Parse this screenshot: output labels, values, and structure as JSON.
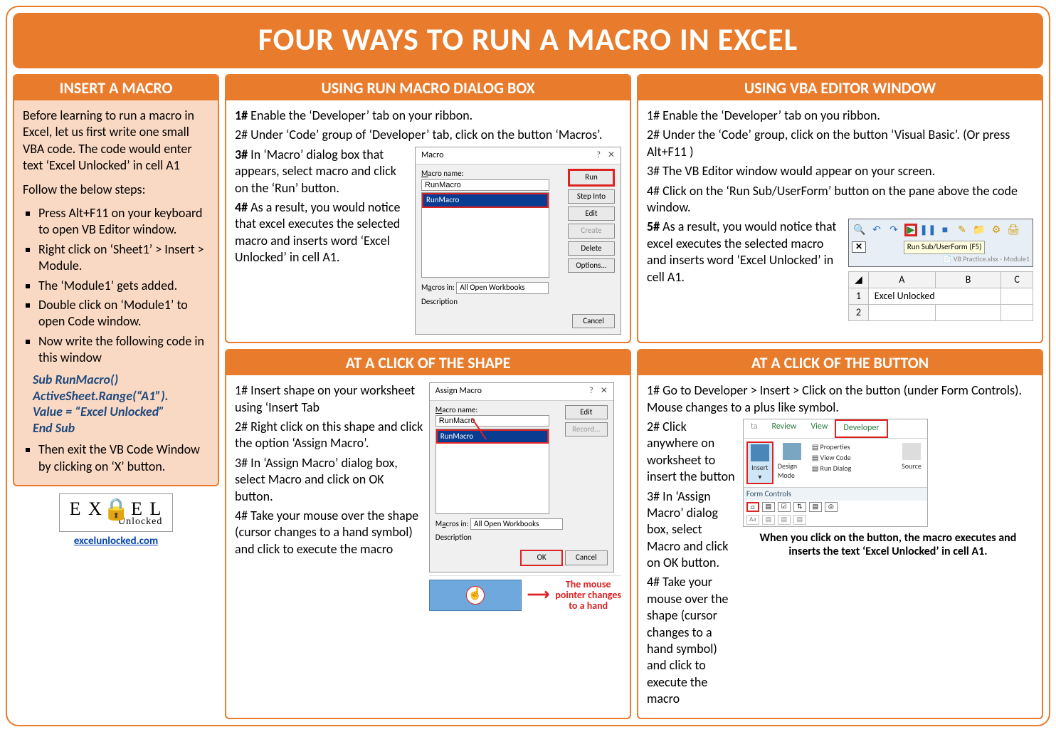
{
  "title": "FOUR WAYS TO RUN A MACRO IN EXCEL",
  "left": {
    "header": "INSERT A MACRO",
    "intro": "Before learning to run a macro in Excel, let us first write one small VBA code. The code would enter text ‘Excel Unlocked’ in cell A1",
    "follow": "Follow the below steps:",
    "steps": [
      "Press Alt+F11 on your keyboard to open VB Editor window.",
      "Right click on ‘Sheet1’ > Insert > Module.",
      "The ‘Module1’ gets added.",
      "Double click on ‘Module1’ to open Code window.",
      "Now write the following code in this window"
    ],
    "code": {
      "l1": "Sub RunMacro()",
      "l2": "ActiveSheet.Range(“A1”).",
      "l3": "Value = “Excel Unlocked”",
      "l4": "End Sub"
    },
    "after": "Then exit the VB Code Window by clicking on ‘X’ button.",
    "logo_top": "E X   E L",
    "logo_mid": "●",
    "logo_bottom": "Unlocked",
    "site": "excelunlocked.com"
  },
  "p1": {
    "header": "USING RUN MACRO DIALOG BOX",
    "s1a": "1#",
    "s1b": " Enable the ‘Developer’ tab on your ribbon.",
    "s2": "2# Under ‘Code’ group of ‘Developer’ tab, click on the button ‘Macros’.",
    "s3a": "3#",
    "s3b": " In ‘Macro’ dialog box that appears, select macro and click on the ‘Run’ button.",
    "s4a": "4#",
    "s4b": " As a result, you would notice that excel executes the selected macro and inserts word ‘Excel Unlocked’ in cell A1.",
    "dialog": {
      "title": "Macro",
      "name_lbl": "Macro name:",
      "name_val": "RunMacro",
      "selected": "RunMacro",
      "btns": {
        "run": "Run",
        "step": "Step Into",
        "edit": "Edit",
        "create": "Create",
        "delete": "Delete",
        "options": "Options..."
      },
      "in_lbl": "Macros in:",
      "in_val": "All Open Workbooks",
      "desc_lbl": "Description",
      "cancel": "Cancel"
    }
  },
  "p2": {
    "header": "USING VBA EDITOR WINDOW",
    "s1": "1# Enable the ‘Developer’ tab on you ribbon.",
    "s2": "2# Under the ‘Code’ group, click on the button ‘Visual Basic’. (Or press Alt+F11 )",
    "s3": "3# The VB Editor window would appear on your screen.",
    "s4": "4# Click on the ‘Run Sub/UserForm’ button on the pane above the code window.",
    "s5a": "5#",
    "s5b": " As a result, you would notice that excel executes the selected macro and inserts word ‘Excel Unlocked’ in cell A1.",
    "tooltip": "Run Sub/UserForm (F5)",
    "tab_caption": "VB Practice.xlsx - Module1",
    "grid": {
      "A": "A",
      "B": "B",
      "C": "C",
      "r1": "1",
      "r2": "2",
      "val": "Excel Unlocked"
    }
  },
  "p3": {
    "header": "AT A CLICK OF THE SHAPE",
    "s1": "1# Insert shape on your worksheet using ‘Insert Tab",
    "s2": "2# Right click on this shape and click the option ‘Assign Macro’.",
    "s3": "3# In ‘Assign Macro’ dialog box, select Macro and click on OK button.",
    "s4": "4# Take your mouse over the shape (cursor changes to a hand symbol) and click to execute the macro",
    "dialog": {
      "title": "Assign Macro",
      "name_lbl": "Macro name:",
      "name_val": "RunMacro",
      "selected": "RunMacro",
      "edit": "Edit",
      "record": "Record...",
      "in_lbl": "Macros in:",
      "in_val": "All Open Workbooks",
      "desc_lbl": "Description",
      "ok": "OK",
      "cancel": "Cancel"
    },
    "hand_caption_1": "The mouse",
    "hand_caption_2": "pointer changes",
    "hand_caption_3": "to a hand"
  },
  "p4": {
    "header": "AT A CLICK OF THE BUTTON",
    "s1": "1# Go to Developer > Insert > Click on the button (under Form Controls). Mouse changes to a plus like symbol.",
    "s2": "2# Click anywhere on worksheet to insert the button",
    "s3": "3# In ‘Assign Macro’ dialog box, select Macro and click on OK button.",
    "s4": "4# Take your mouse over the shape (cursor changes to a hand symbol) and click to execute the macro",
    "ribbon": {
      "t1": "ta",
      "t2": "Review",
      "t3": "View",
      "t4": "Developer",
      "insert": "Insert",
      "design": "Design Mode",
      "props": "Properties",
      "code": "View Code",
      "dialog": "Run Dialog",
      "source": "Source",
      "fc": "Form Controls"
    },
    "caption": "When you click on the button, the macro executes and inserts the text ‘Excel Unlocked’ in cell A1."
  }
}
